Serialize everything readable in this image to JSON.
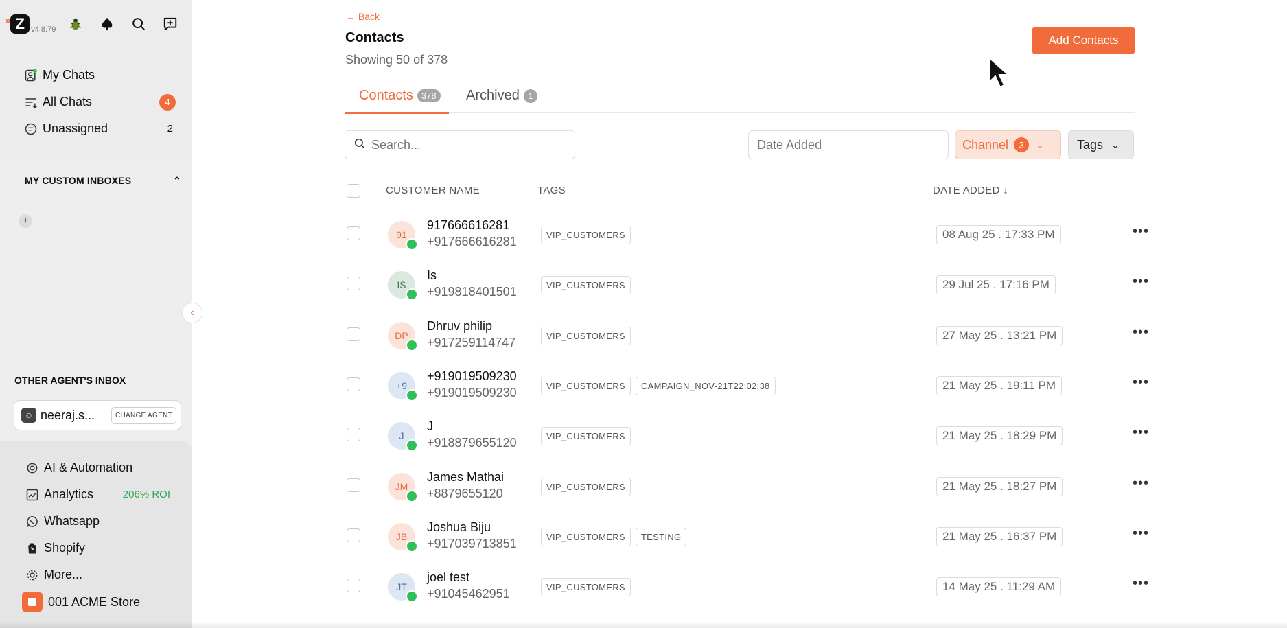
{
  "brand": {
    "version": "v4.8.79",
    "arrows": "»"
  },
  "sidebar": {
    "nav": [
      {
        "label": "My Chats",
        "icon": "chat-user-icon"
      },
      {
        "label": "All Chats",
        "icon": "filter-list-icon",
        "badge": "4"
      },
      {
        "label": "Unassigned",
        "icon": "message-icon",
        "count": "2"
      }
    ],
    "custom_inboxes_title": "MY CUSTOM INBOXES",
    "other_agents_title": "OTHER AGENT'S INBOX",
    "agent_name": "neeraj.s...",
    "change_agent_label": "CHANGE AGENT",
    "bottom": [
      {
        "label": "AI & Automation",
        "icon": "ai-icon"
      },
      {
        "label": "Analytics",
        "icon": "analytics-icon",
        "extra": "206% ROI"
      },
      {
        "label": "Whatsapp",
        "icon": "whatsapp-icon"
      },
      {
        "label": "Shopify",
        "icon": "shopify-icon"
      },
      {
        "label": "More...",
        "icon": "gear-icon"
      }
    ],
    "store_name": "001 ACME Store"
  },
  "page": {
    "back_label": "Back",
    "title": "Contacts",
    "showing": "Showing 50 of 378",
    "add_button": "Add Contacts"
  },
  "tabs": [
    {
      "label": "Contacts",
      "count": "378"
    },
    {
      "label": "Archived",
      "count": "1"
    }
  ],
  "filters": {
    "search_placeholder": "Search...",
    "date_placeholder": "Date Added",
    "channel_label": "Channel",
    "channel_count": "3",
    "tags_label": "Tags"
  },
  "table": {
    "headers": {
      "name": "CUSTOMER NAME",
      "tags": "TAGS",
      "date": "DATE ADDED ↓"
    },
    "rows": [
      {
        "initials": "91",
        "name": "917666616281",
        "phone": "+917666616281",
        "tags": [
          "VIP_CUSTOMERS"
        ],
        "date": "08 Aug 25 . 17:33 PM",
        "avatar_bg": "#fbe3d9",
        "avatar_fg": "#e0704a"
      },
      {
        "initials": "IS",
        "name": "Is",
        "phone": "+919818401501",
        "tags": [
          "VIP_CUSTOMERS"
        ],
        "date": "29 Jul 25 . 17:16 PM",
        "avatar_bg": "#dbe8df",
        "avatar_fg": "#3f7a52"
      },
      {
        "initials": "DP",
        "name": "Dhruv philip",
        "phone": "+917259114747",
        "tags": [
          "VIP_CUSTOMERS"
        ],
        "date": "27 May 25 . 13:21 PM",
        "avatar_bg": "#fbe3d9",
        "avatar_fg": "#e0704a"
      },
      {
        "initials": "+9",
        "name": "+919019509230",
        "phone": "+919019509230",
        "tags": [
          "VIP_CUSTOMERS",
          "CAMPAIGN_NOV-21T22:02:38"
        ],
        "date": "21 May 25 . 19:11 PM",
        "avatar_bg": "#dde6f3",
        "avatar_fg": "#4a6fa5"
      },
      {
        "initials": "J",
        "name": "J",
        "phone": "+918879655120",
        "tags": [
          "VIP_CUSTOMERS"
        ],
        "date": "21 May 25 . 18:29 PM",
        "avatar_bg": "#dde6f3",
        "avatar_fg": "#4a6fa5"
      },
      {
        "initials": "JM",
        "name": "James Mathai",
        "phone": "+8879655120",
        "tags": [
          "VIP_CUSTOMERS"
        ],
        "date": "21 May 25 . 18:27 PM",
        "avatar_bg": "#fbe3d9",
        "avatar_fg": "#e0704a"
      },
      {
        "initials": "JB",
        "name": "Joshua Biju",
        "phone": "+917039713851",
        "tags": [
          "VIP_CUSTOMERS",
          "TESTING"
        ],
        "date": "21 May 25 . 16:37 PM",
        "avatar_bg": "#fbe3d9",
        "avatar_fg": "#e0704a"
      },
      {
        "initials": "JT",
        "name": "joel test",
        "phone": "+91045462951",
        "tags": [
          "VIP_CUSTOMERS"
        ],
        "date": "14 May 25 . 11:29 AM",
        "avatar_bg": "#dde6f3",
        "avatar_fg": "#4a6fa5"
      }
    ]
  },
  "colors": {
    "accent": "#f26b3a",
    "whatsapp": "#2fc05a",
    "roi": "#2fa84f"
  }
}
